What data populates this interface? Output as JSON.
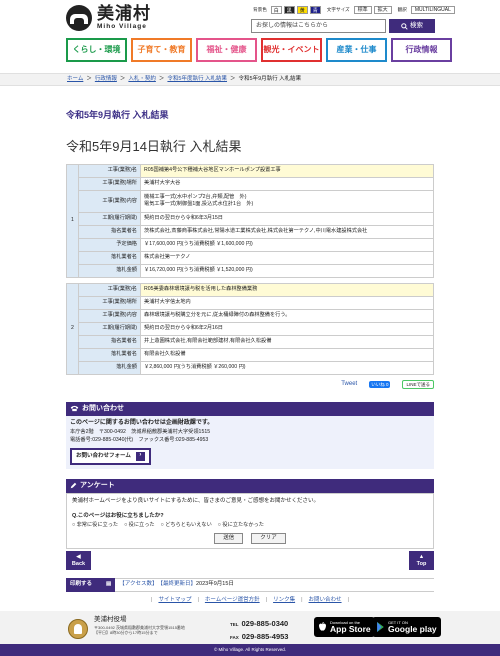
{
  "header": {
    "logo_jp": "美浦村",
    "logo_en": "Miho Village",
    "bg_label": "背景色",
    "bg_colors": [
      "白",
      "黒",
      "黄",
      "青"
    ],
    "size_label": "文字サイズ",
    "size_options": [
      "標準",
      "拡大"
    ],
    "lang_label": "翻訳",
    "lang_button": "MULTILINGUAL",
    "search_placeholder": "お探しの情報はこちらから",
    "search_button": "検索"
  },
  "gnav": [
    {
      "label": "くらし・環境",
      "color": "#1a9a4a"
    },
    {
      "label": "子育て・教育",
      "color": "#f07a28"
    },
    {
      "label": "福祉・健康",
      "color": "#e4548a"
    },
    {
      "label": "観光・イベント",
      "color": "#e03030"
    },
    {
      "label": "産業・仕事",
      "color": "#1e8acb"
    },
    {
      "label": "行政情報",
      "color": "#6a3fa0"
    }
  ],
  "breadcrumb": [
    "ホーム",
    "行政情報",
    "入札・契約",
    "令和5年度執行 入札結果",
    "令和5年9月執行 入札結果"
  ],
  "page_title": "令和5年9月執行 入札結果",
  "section_title": "令和5年9月14日執行 入札結果",
  "results": [
    {
      "num": "1",
      "rows": [
        {
          "k": "工事(業務)名",
          "v": "R05国補第4号公下種補大谷地区マンホールポンプ設置工事"
        },
        {
          "k": "工事(業務)場所",
          "v": "美浦村大字大谷"
        },
        {
          "k": "工事(業務)内容",
          "v": "機械工事一式(水中ポンプ2台,弁類,配管　外)\n電気工事一式(制御盤1面,投込式水位計1台　外)"
        },
        {
          "k": "工期(履行期間)",
          "v": "契約日の翌日から令和6年3月15日"
        },
        {
          "k": "指名業者名",
          "v": "茨株式会社,斎藤商事株式会社,常陽水道工業株式会社,株式会社第一テクノ,中川電水建設株式会社"
        },
        {
          "k": "予定価格",
          "v": "￥17,600,000 円(うち消費税額 ￥1,600,000 円)"
        },
        {
          "k": "落札業者名",
          "v": "株式会社第一テクノ"
        },
        {
          "k": "落札金額",
          "v": "￥16,720,000 円(うち消費税額 ￥1,520,000 円)"
        }
      ]
    },
    {
      "num": "2",
      "rows": [
        {
          "k": "工事(業務)名",
          "v": "R05美委森林環境譲与税を活用した森林整備業務"
        },
        {
          "k": "工事(業務)場所",
          "v": "美浦村大字信太地内"
        },
        {
          "k": "工事(業務)内容",
          "v": "森林環境譲与税購立分を元に,従太桶緑陣付の森林整備を行う。"
        },
        {
          "k": "工期(履行期間)",
          "v": "契約日の翌日から令和6年2月16日"
        },
        {
          "k": "指名業者名",
          "v": "井上造園株式会社,有限会社範部建材,有限会社久松設備"
        },
        {
          "k": "落札業者名",
          "v": "有限会社久松設備"
        },
        {
          "k": "落札金額",
          "v": "￥2,860,000 円(うち消費税額 ￥260,000 円)"
        }
      ]
    }
  ],
  "share": {
    "tweet": "Tweet",
    "facebook": "いいね 0",
    "line": "LINEで送る"
  },
  "contact": {
    "heading": "お問い合わせ",
    "title": "このページに関するお問い合わせは企画財政課です。",
    "address": "本庁舎2階　〒300-0492　茨城県稲敷郡美浦村大字受領1515",
    "tel": "電話番号:029-885-0340(代)　ファックス番号:029-885-4953",
    "form_button": "お問い合わせフォーム"
  },
  "survey": {
    "heading": "アンケート",
    "intro": "美浦村ホームページをより良いサイトにするために、皆さまのご意見・ご感想をお聞かせください。",
    "question": "Q.このページはお役に立ちましたか?",
    "options": [
      "非常に役に立った",
      "役に立った",
      "どちらともいえない",
      "役に立たなかった"
    ],
    "submit": "送信",
    "clear": "クリア"
  },
  "nav_buttons": {
    "back": "Back",
    "top": "Top"
  },
  "meta": {
    "print": "印刷する",
    "access": "【アクセス数】",
    "updated_label": "【最終更新日】",
    "updated": "2023年9月15日"
  },
  "footer_links": [
    "サイトマップ",
    "ホームページ運営方針",
    "リンク集",
    "お問い合わせ"
  ],
  "footer": {
    "office": "美浦村役場",
    "address1": "〒300-0492 茨城県稲敷郡美浦村大字受領1515番地",
    "address2": "【平日】8時30分から17時15分まで",
    "tel": "029-885-0340",
    "fax": "029-885-4953",
    "tel_label": "TEL",
    "fax_label": "FAX",
    "appstore_small": "Download on the",
    "appstore_big": "App Store",
    "gplay_small": "GET IT ON",
    "gplay_big": "Google play"
  },
  "copyright": "© Miho Village. All Rights Reserved."
}
